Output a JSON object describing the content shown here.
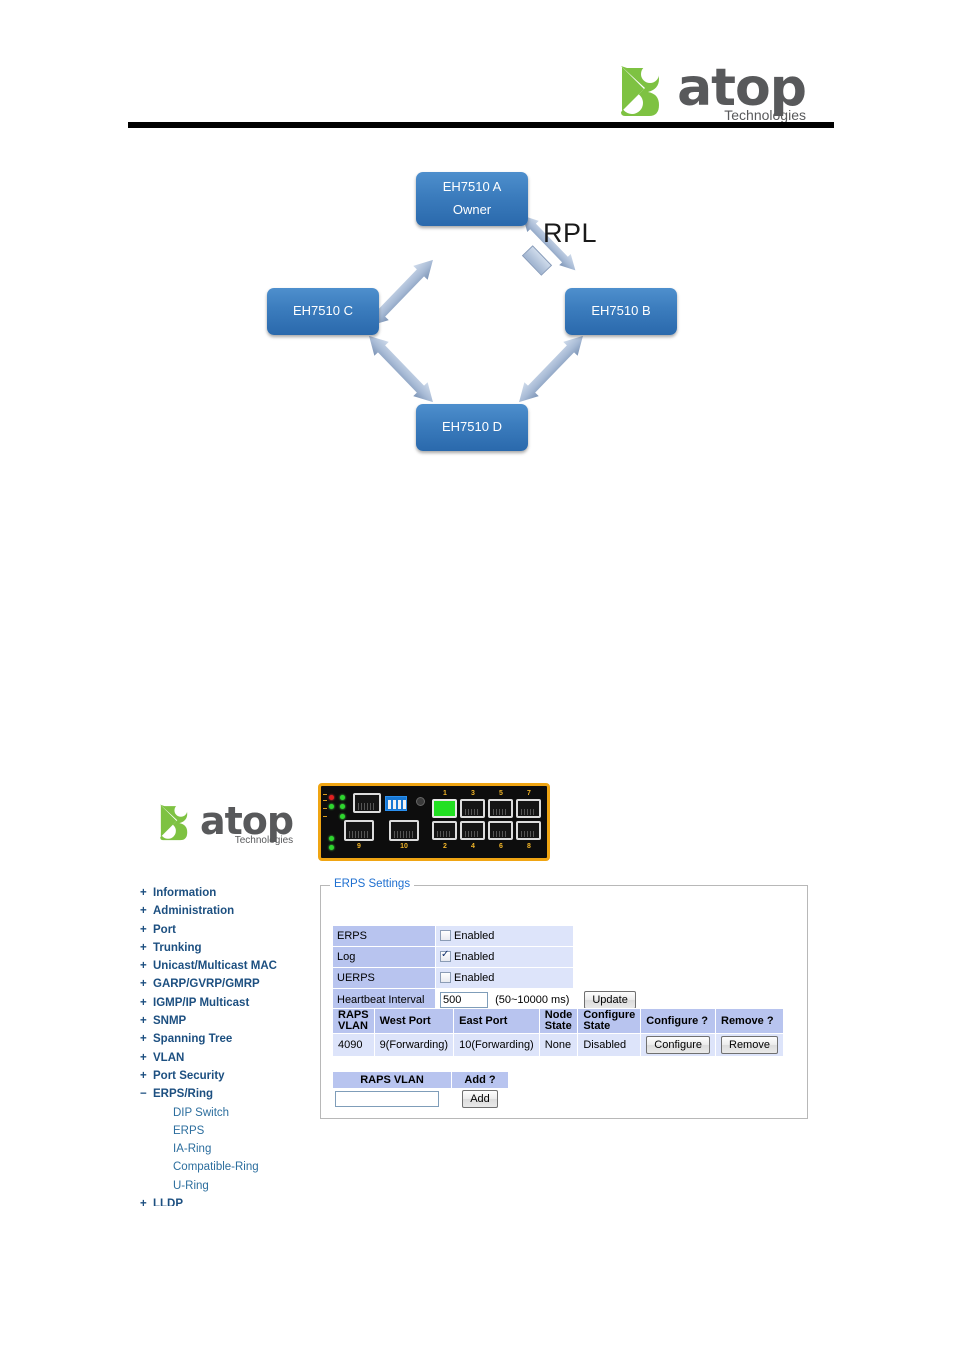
{
  "header": {
    "logo": {
      "word": "atop",
      "sub": "Technologies",
      "mark_name": "atop-leaf-mark"
    }
  },
  "diagram": {
    "type": "ring-topology",
    "rpl_label": "RPL",
    "nodes": [
      {
        "id": "a",
        "line1": "EH7510 A",
        "line2": "Owner"
      },
      {
        "id": "b",
        "line1": "EH7510 B",
        "line2": ""
      },
      {
        "id": "c",
        "line1": "EH7510 C",
        "line2": ""
      },
      {
        "id": "d",
        "line1": "EH7510 D",
        "line2": ""
      }
    ],
    "colors": {
      "node_fill_top": "#4e8fcd",
      "node_fill_bottom": "#2a69ac",
      "arrow_fill": "#9fb3cf",
      "node_text": "#ffffff"
    }
  },
  "device": {
    "name": "EH7510 industrial switch front panel",
    "bezel_color": "#f0a513",
    "active_port_color": "#22e022",
    "port_labels_top": [
      "1",
      "3",
      "5",
      "7"
    ],
    "port_labels_bottom": [
      "2",
      "4",
      "6",
      "8"
    ],
    "sfp_labels": [
      "9",
      "10"
    ],
    "logo": {
      "word": "atop",
      "sub": "Technologies"
    }
  },
  "sidebar": {
    "items": [
      {
        "label": "Information",
        "toggle": "+",
        "level": "top"
      },
      {
        "label": "Administration",
        "toggle": "+",
        "level": "top"
      },
      {
        "label": "Port",
        "toggle": "+",
        "level": "top"
      },
      {
        "label": "Trunking",
        "toggle": "+",
        "level": "top"
      },
      {
        "label": "Unicast/Multicast MAC",
        "toggle": "+",
        "level": "top"
      },
      {
        "label": "GARP/GVRP/GMRP",
        "toggle": "+",
        "level": "top"
      },
      {
        "label": "IGMP/IP Multicast",
        "toggle": "+",
        "level": "top"
      },
      {
        "label": "SNMP",
        "toggle": "+",
        "level": "top"
      },
      {
        "label": "Spanning Tree",
        "toggle": "+",
        "level": "top"
      },
      {
        "label": "VLAN",
        "toggle": "+",
        "level": "top"
      },
      {
        "label": "Port Security",
        "toggle": "+",
        "level": "top"
      },
      {
        "label": "ERPS/Ring",
        "toggle": "−",
        "level": "top"
      },
      {
        "label": "DIP Switch",
        "toggle": "",
        "level": "sub"
      },
      {
        "label": "ERPS",
        "toggle": "",
        "level": "sub"
      },
      {
        "label": "IA-Ring",
        "toggle": "",
        "level": "sub"
      },
      {
        "label": "Compatible-Ring",
        "toggle": "",
        "level": "sub"
      },
      {
        "label": "U-Ring",
        "toggle": "",
        "level": "sub"
      },
      {
        "label": "LLDP",
        "toggle": "+",
        "level": "top"
      }
    ],
    "colors": {
      "top_text": "#1c4f80",
      "sub_text": "#2c6e9e"
    }
  },
  "erps_panel": {
    "legend": "ERPS Settings",
    "settings": [
      {
        "label": "ERPS",
        "checkbox_checked": false,
        "checkbox_label": "Enabled"
      },
      {
        "label": "Log",
        "checkbox_checked": true,
        "checkbox_label": "Enabled"
      },
      {
        "label": "UERPS",
        "checkbox_checked": false,
        "checkbox_label": "Enabled"
      }
    ],
    "heartbeat": {
      "label": "Heartbeat Interval",
      "value": "500",
      "placeholder": "",
      "range_hint": "(50~10000 ms)",
      "update_button": "Update"
    },
    "raps_table": {
      "headers": [
        "RAPS VLAN",
        "West Port",
        "East Port",
        "Node State",
        "Configure State",
        "Configure ?",
        "Remove ?"
      ],
      "header_lines": [
        [
          "RAPS",
          "VLAN"
        ],
        [
          "West Port",
          ""
        ],
        [
          "East Port",
          ""
        ],
        [
          "Node",
          "State"
        ],
        [
          "Configure",
          "State"
        ],
        [
          "Configure ?",
          ""
        ],
        [
          "Remove ?",
          ""
        ]
      ],
      "rows": [
        {
          "raps_vlan": "4090",
          "west_port": "9(Forwarding)",
          "east_port": "10(Forwarding)",
          "node_state": "None",
          "configure_state": "Disabled",
          "configure_button": "Configure",
          "remove_button": "Remove"
        }
      ]
    },
    "add_section": {
      "col_vlan": "RAPS VLAN",
      "col_add": "Add ?",
      "input_value": "",
      "input_placeholder": "",
      "add_button": "Add"
    },
    "colors": {
      "legend_text": "#1e6fd0",
      "header_bg": "#b8c4ef",
      "cell_bg": "#dde4fa",
      "panel_border": "#b8b8b8"
    }
  }
}
